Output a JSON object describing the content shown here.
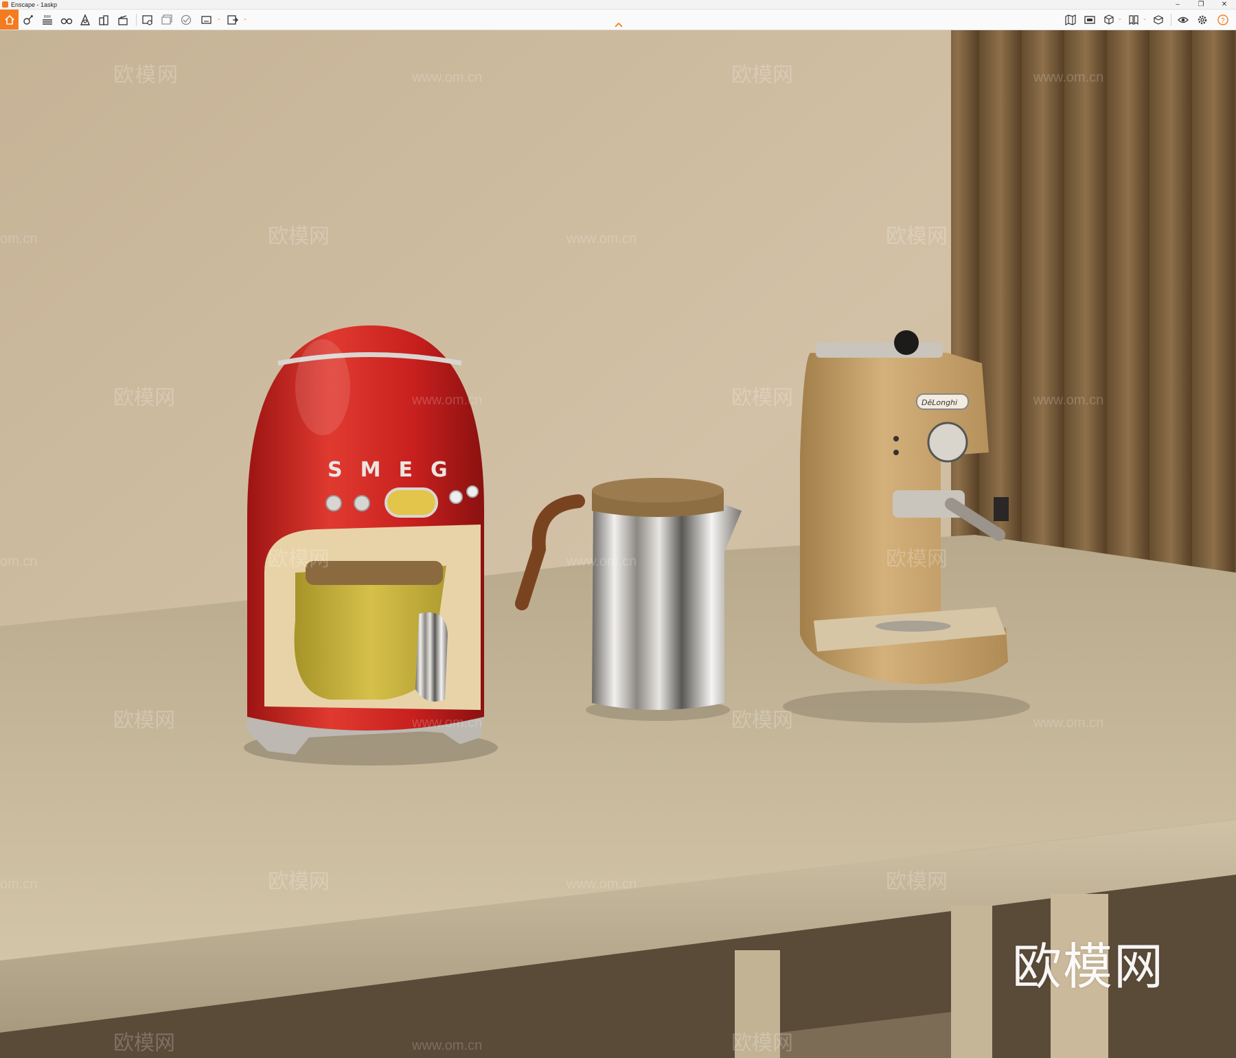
{
  "window": {
    "title": "Enscape - 1askp"
  },
  "toolbar": {
    "bim_label": "BIM",
    "left_icons": [
      "home-icon",
      "asset-library-icon",
      "bim-icon",
      "binoculars-icon",
      "light-view-icon",
      "buildings-icon",
      "clapperboard-icon",
      "render-icon",
      "batch-render-icon",
      "panorama-icon",
      "video-icon",
      "export-icon"
    ],
    "right_icons": [
      "map-icon",
      "screenshot-icon",
      "cube-icon",
      "bookmark-icon",
      "capture-icon",
      "visibility-icon",
      "settings-icon",
      "help-icon"
    ]
  },
  "scene": {
    "coffee_maker_brand": "SMEG",
    "espresso_brand": "DēLonghi",
    "watermark_brand": "欧模网",
    "watermark_url": "www.om.cn",
    "watermark_url_short": "om.cn",
    "colors": {
      "wall": "#cbb89c",
      "table": "#cfc1a3",
      "smeg_red": "#c8201e",
      "espresso_beige": "#c9a46a",
      "accent": "#f47b20"
    }
  }
}
